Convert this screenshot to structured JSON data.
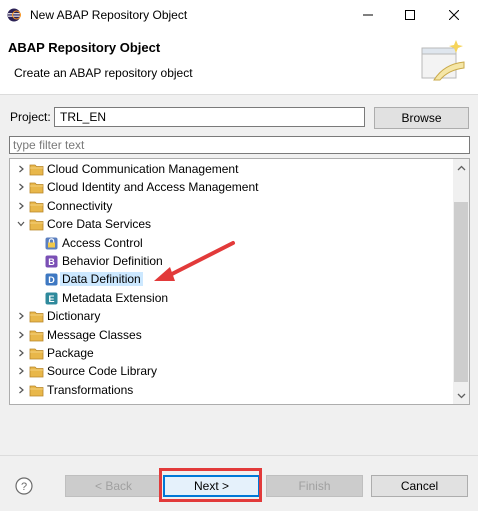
{
  "window": {
    "title": "New ABAP Repository Object"
  },
  "header": {
    "title": "ABAP Repository Object",
    "subtitle": "Create an ABAP repository object"
  },
  "project": {
    "label": "Project:",
    "value": "TRL_EN",
    "browse_label": "Browse"
  },
  "filter": {
    "placeholder": "type filter text"
  },
  "tree": {
    "items": [
      {
        "label": "Cloud Communication Management",
        "icon": "folder-icon",
        "expanded": false,
        "level": 0
      },
      {
        "label": "Cloud Identity and Access Management",
        "icon": "folder-icon",
        "expanded": false,
        "level": 0
      },
      {
        "label": "Connectivity",
        "icon": "folder-icon",
        "expanded": false,
        "level": 0
      },
      {
        "label": "Core Data Services",
        "icon": "folder-icon",
        "expanded": true,
        "level": 0
      },
      {
        "label": "Access Control",
        "icon": "access-control-icon",
        "level": 1
      },
      {
        "label": "Behavior Definition",
        "icon": "behavior-definition-icon",
        "level": 1
      },
      {
        "label": "Data Definition",
        "icon": "data-definition-icon",
        "level": 1,
        "selected": true
      },
      {
        "label": "Metadata Extension",
        "icon": "metadata-extension-icon",
        "level": 1
      },
      {
        "label": "Dictionary",
        "icon": "folder-icon",
        "expanded": false,
        "level": 0
      },
      {
        "label": "Message Classes",
        "icon": "folder-icon",
        "expanded": false,
        "level": 0
      },
      {
        "label": "Package",
        "icon": "folder-icon",
        "expanded": false,
        "level": 0
      },
      {
        "label": "Source Code Library",
        "icon": "folder-icon",
        "expanded": false,
        "level": 0
      },
      {
        "label": "Transformations",
        "icon": "folder-icon",
        "expanded": false,
        "level": 0
      }
    ]
  },
  "footer": {
    "back_label": "< Back",
    "next_label": "Next >",
    "finish_label": "Finish",
    "cancel_label": "Cancel"
  },
  "colors": {
    "annotation_red": "#e23a3a",
    "selection": "#cce8ff",
    "folder": "#e8b74a"
  }
}
